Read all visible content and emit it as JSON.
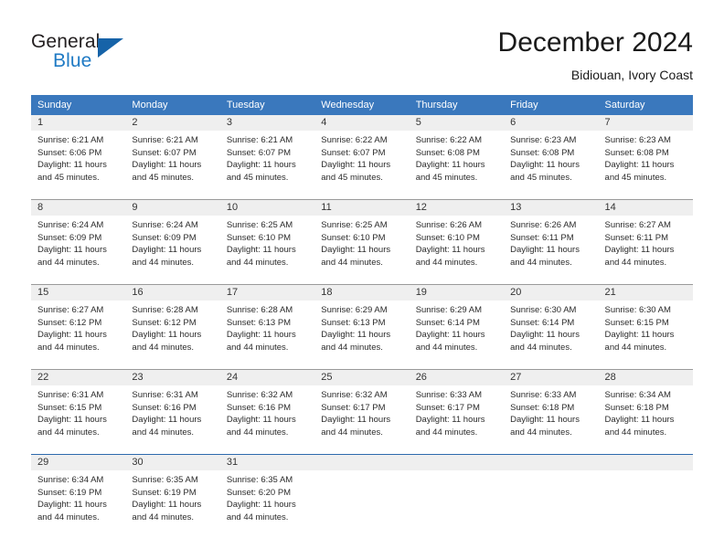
{
  "logo": {
    "word_general": "General",
    "word_blue": "Blue",
    "triangle_color": "#1663a8",
    "blue_color": "#1f7ac4"
  },
  "header": {
    "title": "December 2024",
    "subtitle": "Bidiouan, Ivory Coast"
  },
  "theme": {
    "header_blue": "#3a78bd",
    "day_band_gray": "#efefef",
    "separator_gray": "#9a9a9a",
    "separator_blue": "#2d6aad"
  },
  "weekday_headers": [
    "Sunday",
    "Monday",
    "Tuesday",
    "Wednesday",
    "Thursday",
    "Friday",
    "Saturday"
  ],
  "weeks": [
    {
      "separator": null,
      "days": [
        {
          "date": "1",
          "sunrise": "Sunrise: 6:21 AM",
          "sunset": "Sunset: 6:06 PM",
          "daylight_line1": "Daylight: 11 hours",
          "daylight_line2": "and 45 minutes."
        },
        {
          "date": "2",
          "sunrise": "Sunrise: 6:21 AM",
          "sunset": "Sunset: 6:07 PM",
          "daylight_line1": "Daylight: 11 hours",
          "daylight_line2": "and 45 minutes."
        },
        {
          "date": "3",
          "sunrise": "Sunrise: 6:21 AM",
          "sunset": "Sunset: 6:07 PM",
          "daylight_line1": "Daylight: 11 hours",
          "daylight_line2": "and 45 minutes."
        },
        {
          "date": "4",
          "sunrise": "Sunrise: 6:22 AM",
          "sunset": "Sunset: 6:07 PM",
          "daylight_line1": "Daylight: 11 hours",
          "daylight_line2": "and 45 minutes."
        },
        {
          "date": "5",
          "sunrise": "Sunrise: 6:22 AM",
          "sunset": "Sunset: 6:08 PM",
          "daylight_line1": "Daylight: 11 hours",
          "daylight_line2": "and 45 minutes."
        },
        {
          "date": "6",
          "sunrise": "Sunrise: 6:23 AM",
          "sunset": "Sunset: 6:08 PM",
          "daylight_line1": "Daylight: 11 hours",
          "daylight_line2": "and 45 minutes."
        },
        {
          "date": "7",
          "sunrise": "Sunrise: 6:23 AM",
          "sunset": "Sunset: 6:08 PM",
          "daylight_line1": "Daylight: 11 hours",
          "daylight_line2": "and 45 minutes."
        }
      ]
    },
    {
      "separator": "gray",
      "days": [
        {
          "date": "8",
          "sunrise": "Sunrise: 6:24 AM",
          "sunset": "Sunset: 6:09 PM",
          "daylight_line1": "Daylight: 11 hours",
          "daylight_line2": "and 44 minutes."
        },
        {
          "date": "9",
          "sunrise": "Sunrise: 6:24 AM",
          "sunset": "Sunset: 6:09 PM",
          "daylight_line1": "Daylight: 11 hours",
          "daylight_line2": "and 44 minutes."
        },
        {
          "date": "10",
          "sunrise": "Sunrise: 6:25 AM",
          "sunset": "Sunset: 6:10 PM",
          "daylight_line1": "Daylight: 11 hours",
          "daylight_line2": "and 44 minutes."
        },
        {
          "date": "11",
          "sunrise": "Sunrise: 6:25 AM",
          "sunset": "Sunset: 6:10 PM",
          "daylight_line1": "Daylight: 11 hours",
          "daylight_line2": "and 44 minutes."
        },
        {
          "date": "12",
          "sunrise": "Sunrise: 6:26 AM",
          "sunset": "Sunset: 6:10 PM",
          "daylight_line1": "Daylight: 11 hours",
          "daylight_line2": "and 44 minutes."
        },
        {
          "date": "13",
          "sunrise": "Sunrise: 6:26 AM",
          "sunset": "Sunset: 6:11 PM",
          "daylight_line1": "Daylight: 11 hours",
          "daylight_line2": "and 44 minutes."
        },
        {
          "date": "14",
          "sunrise": "Sunrise: 6:27 AM",
          "sunset": "Sunset: 6:11 PM",
          "daylight_line1": "Daylight: 11 hours",
          "daylight_line2": "and 44 minutes."
        }
      ]
    },
    {
      "separator": "gray",
      "days": [
        {
          "date": "15",
          "sunrise": "Sunrise: 6:27 AM",
          "sunset": "Sunset: 6:12 PM",
          "daylight_line1": "Daylight: 11 hours",
          "daylight_line2": "and 44 minutes."
        },
        {
          "date": "16",
          "sunrise": "Sunrise: 6:28 AM",
          "sunset": "Sunset: 6:12 PM",
          "daylight_line1": "Daylight: 11 hours",
          "daylight_line2": "and 44 minutes."
        },
        {
          "date": "17",
          "sunrise": "Sunrise: 6:28 AM",
          "sunset": "Sunset: 6:13 PM",
          "daylight_line1": "Daylight: 11 hours",
          "daylight_line2": "and 44 minutes."
        },
        {
          "date": "18",
          "sunrise": "Sunrise: 6:29 AM",
          "sunset": "Sunset: 6:13 PM",
          "daylight_line1": "Daylight: 11 hours",
          "daylight_line2": "and 44 minutes."
        },
        {
          "date": "19",
          "sunrise": "Sunrise: 6:29 AM",
          "sunset": "Sunset: 6:14 PM",
          "daylight_line1": "Daylight: 11 hours",
          "daylight_line2": "and 44 minutes."
        },
        {
          "date": "20",
          "sunrise": "Sunrise: 6:30 AM",
          "sunset": "Sunset: 6:14 PM",
          "daylight_line1": "Daylight: 11 hours",
          "daylight_line2": "and 44 minutes."
        },
        {
          "date": "21",
          "sunrise": "Sunrise: 6:30 AM",
          "sunset": "Sunset: 6:15 PM",
          "daylight_line1": "Daylight: 11 hours",
          "daylight_line2": "and 44 minutes."
        }
      ]
    },
    {
      "separator": "gray",
      "days": [
        {
          "date": "22",
          "sunrise": "Sunrise: 6:31 AM",
          "sunset": "Sunset: 6:15 PM",
          "daylight_line1": "Daylight: 11 hours",
          "daylight_line2": "and 44 minutes."
        },
        {
          "date": "23",
          "sunrise": "Sunrise: 6:31 AM",
          "sunset": "Sunset: 6:16 PM",
          "daylight_line1": "Daylight: 11 hours",
          "daylight_line2": "and 44 minutes."
        },
        {
          "date": "24",
          "sunrise": "Sunrise: 6:32 AM",
          "sunset": "Sunset: 6:16 PM",
          "daylight_line1": "Daylight: 11 hours",
          "daylight_line2": "and 44 minutes."
        },
        {
          "date": "25",
          "sunrise": "Sunrise: 6:32 AM",
          "sunset": "Sunset: 6:17 PM",
          "daylight_line1": "Daylight: 11 hours",
          "daylight_line2": "and 44 minutes."
        },
        {
          "date": "26",
          "sunrise": "Sunrise: 6:33 AM",
          "sunset": "Sunset: 6:17 PM",
          "daylight_line1": "Daylight: 11 hours",
          "daylight_line2": "and 44 minutes."
        },
        {
          "date": "27",
          "sunrise": "Sunrise: 6:33 AM",
          "sunset": "Sunset: 6:18 PM",
          "daylight_line1": "Daylight: 11 hours",
          "daylight_line2": "and 44 minutes."
        },
        {
          "date": "28",
          "sunrise": "Sunrise: 6:34 AM",
          "sunset": "Sunset: 6:18 PM",
          "daylight_line1": "Daylight: 11 hours",
          "daylight_line2": "and 44 minutes."
        }
      ]
    },
    {
      "separator": "blue",
      "days": [
        {
          "date": "29",
          "sunrise": "Sunrise: 6:34 AM",
          "sunset": "Sunset: 6:19 PM",
          "daylight_line1": "Daylight: 11 hours",
          "daylight_line2": "and 44 minutes."
        },
        {
          "date": "30",
          "sunrise": "Sunrise: 6:35 AM",
          "sunset": "Sunset: 6:19 PM",
          "daylight_line1": "Daylight: 11 hours",
          "daylight_line2": "and 44 minutes."
        },
        {
          "date": "31",
          "sunrise": "Sunrise: 6:35 AM",
          "sunset": "Sunset: 6:20 PM",
          "daylight_line1": "Daylight: 11 hours",
          "daylight_line2": "and 44 minutes."
        },
        {
          "date": "",
          "sunrise": "",
          "sunset": "",
          "daylight_line1": "",
          "daylight_line2": ""
        },
        {
          "date": "",
          "sunrise": "",
          "sunset": "",
          "daylight_line1": "",
          "daylight_line2": ""
        },
        {
          "date": "",
          "sunrise": "",
          "sunset": "",
          "daylight_line1": "",
          "daylight_line2": ""
        },
        {
          "date": "",
          "sunrise": "",
          "sunset": "",
          "daylight_line1": "",
          "daylight_line2": ""
        }
      ]
    }
  ]
}
